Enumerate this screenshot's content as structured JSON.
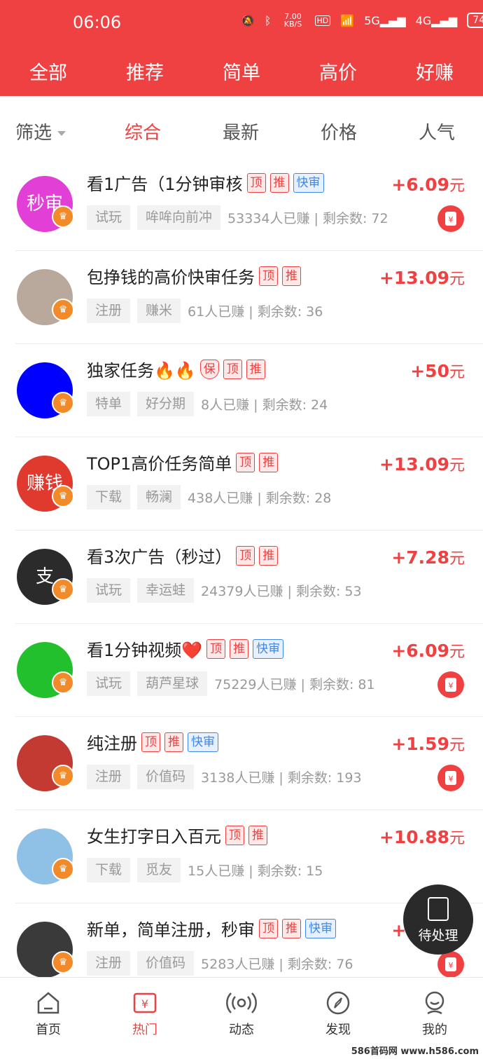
{
  "status_bar": {
    "time": "06:06",
    "speed": "7.00 KB/S",
    "battery": "74"
  },
  "top_tabs": [
    "全部",
    "推荐",
    "简单",
    "高价",
    "好赚"
  ],
  "active_top_tab": "高价",
  "filter_label": "筛选",
  "sort_tabs": [
    "综合",
    "最新",
    "价格",
    "人气"
  ],
  "tasks": [
    {
      "title": "看1广告（1分钟审核",
      "tags": [
        "顶",
        "推",
        "快审"
      ],
      "chip1": "试玩",
      "chip2": "哞哞向前冲",
      "stats": "53334人已赚 | 剩余数: 72",
      "price": "+6.09",
      "unit": "元",
      "avatar_color": "#e23fd6",
      "avatar_text": "秒审",
      "redpack": true
    },
    {
      "title": "包挣钱的高价快审任务",
      "tags": [
        "顶",
        "推"
      ],
      "chip1": "注册",
      "chip2": "赚米",
      "stats": "61人已赚 | 剩余数: 36",
      "price": "+13.09",
      "unit": "元",
      "avatar_color": "#b9a99c",
      "avatar_text": "",
      "redpack": false
    },
    {
      "title": "独家任务🔥🔥",
      "tags": [
        "保",
        "顶",
        "推"
      ],
      "chip1": "特单",
      "chip2": "好分期",
      "stats": "8人已赚 | 剩余数: 24",
      "price": "+50",
      "unit": "元",
      "avatar_color": "#0000ff",
      "avatar_text": "",
      "redpack": false
    },
    {
      "title": "TOP1高价任务简单",
      "tags": [
        "顶",
        "推"
      ],
      "chip1": "下载",
      "chip2": "畅澜",
      "stats": "438人已赚 | 剩余数: 28",
      "price": "+13.09",
      "unit": "元",
      "avatar_color": "#e03a2f",
      "avatar_text": "赚钱",
      "redpack": false
    },
    {
      "title": "看3次广告（秒过）",
      "tags": [
        "顶",
        "推"
      ],
      "chip1": "试玩",
      "chip2": "幸运蛙",
      "stats": "24379人已赚 | 剩余数: 53",
      "price": "+7.28",
      "unit": "元",
      "avatar_color": "#2b2b2b",
      "avatar_text": "支",
      "redpack": false
    },
    {
      "title": "看1分钟视频❤️",
      "tags": [
        "顶",
        "推",
        "快审"
      ],
      "chip1": "试玩",
      "chip2": "葫芦星球",
      "stats": "75229人已赚 | 剩余数: 81",
      "price": "+6.09",
      "unit": "元",
      "avatar_color": "#22c02c",
      "avatar_text": "",
      "redpack": true
    },
    {
      "title": "纯注册",
      "tags": [
        "顶",
        "推",
        "快审"
      ],
      "chip1": "注册",
      "chip2": "价值码",
      "stats": "3138人已赚 | 剩余数: 193",
      "price": "+1.59",
      "unit": "元",
      "avatar_color": "#c23a32",
      "avatar_text": "",
      "redpack": true
    },
    {
      "title": "女生打字日入百元",
      "tags": [
        "顶",
        "推"
      ],
      "chip1": "下载",
      "chip2": "觅友",
      "stats": "15人已赚 | 剩余数: 15",
      "price": "+10.88",
      "unit": "元",
      "avatar_color": "#8fc0e6",
      "avatar_text": "",
      "redpack": false
    },
    {
      "title": "新单，简单注册，秒审",
      "tags": [
        "顶",
        "推",
        "快审"
      ],
      "chip1": "注册",
      "chip2": "价值码",
      "stats": "5283人已赚 | 剩余数: 76",
      "price": "+1.59",
      "unit": "元",
      "avatar_color": "#3a3a3a",
      "avatar_text": "",
      "redpack": true
    }
  ],
  "floating_button": "待处理",
  "bottom_tabs": [
    "首页",
    "热门",
    "动态",
    "发现",
    "我的"
  ],
  "active_bottom_tab": "热门",
  "watermark": "586首码网 www.h586.com",
  "colors": {
    "primary": "#f04142",
    "blue_tag": "#3f86ee"
  }
}
